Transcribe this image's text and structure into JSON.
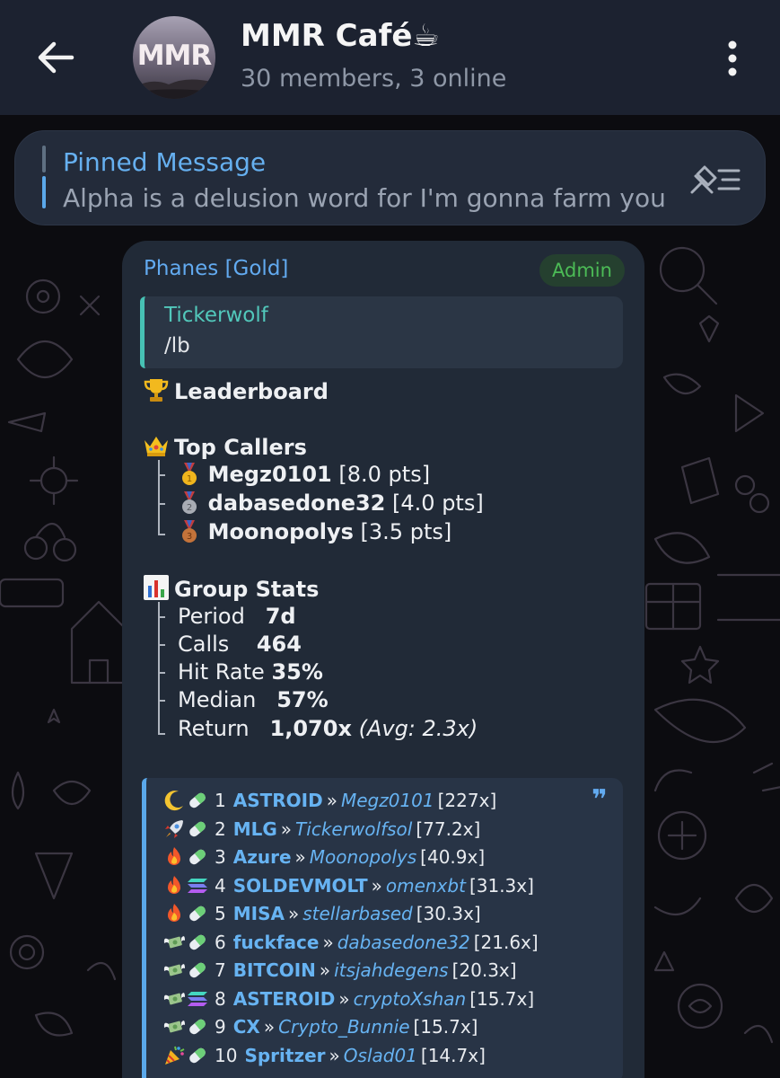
{
  "header": {
    "title": "MMR Café☕",
    "subtitle": "30 members, 3 online",
    "avatar_text": "MMR"
  },
  "pinned": {
    "title": "Pinned Message",
    "text": "Alpha is a delusion word for I'm gonna farm you"
  },
  "message": {
    "sender": "Phanes [Gold]",
    "badge": "Admin",
    "reply": {
      "name": "Tickerwolf",
      "text": "/lb"
    },
    "leaderboard_title": "Leaderboard",
    "top_callers_title": "Top Callers",
    "callers": [
      {
        "medal": "1",
        "name": "Megz0101",
        "pts": "[8.0 pts]"
      },
      {
        "medal": "2",
        "name": "dabasedone32",
        "pts": "[4.0 pts]"
      },
      {
        "medal": "3",
        "name": "Moonopolys",
        "pts": "[3.5 pts]"
      }
    ],
    "group_stats_title": "Group Stats",
    "stats": [
      {
        "label": "Period",
        "value": "7d",
        "extra": ""
      },
      {
        "label": "Calls",
        "value": "464",
        "extra": ""
      },
      {
        "label": "Hit Rate",
        "value": "35%",
        "extra": ""
      },
      {
        "label": "Median",
        "value": "57%",
        "extra": ""
      },
      {
        "label": "Return",
        "value": "1,070x",
        "extra": "(Avg: 2.3x)"
      }
    ],
    "quote_mark": "❞",
    "calls": [
      {
        "icon": "moon",
        "chain": "pill",
        "rank": "1",
        "token": "ASTROID",
        "user": "Megz0101",
        "mult": "[227x]"
      },
      {
        "icon": "rocket",
        "chain": "pill",
        "rank": "2",
        "token": "MLG",
        "user": "Tickerwolfsol",
        "mult": "[77.2x]"
      },
      {
        "icon": "fire",
        "chain": "pill",
        "rank": "3",
        "token": "Azure",
        "user": "Moonopolys",
        "mult": "[40.9x]"
      },
      {
        "icon": "fire",
        "chain": "solana",
        "rank": "4",
        "token": "SOLDEVMOLT",
        "user": "omenxbt",
        "mult": "[31.3x]"
      },
      {
        "icon": "fire",
        "chain": "pill",
        "rank": "5",
        "token": "MISA",
        "user": "stellarbased",
        "mult": "[30.3x]"
      },
      {
        "icon": "money",
        "chain": "pill",
        "rank": "6",
        "token": "fuckface",
        "user": "dabasedone32",
        "mult": "[21.6x]"
      },
      {
        "icon": "money",
        "chain": "pill",
        "rank": "7",
        "token": "BITCOIN",
        "user": "itsjahdegens",
        "mult": "[20.3x]"
      },
      {
        "icon": "money",
        "chain": "solana",
        "rank": "8",
        "token": "ASTEROID",
        "user": "cryptoXshan",
        "mult": "[15.7x]"
      },
      {
        "icon": "money",
        "chain": "pill",
        "rank": "9",
        "token": "CX",
        "user": "Crypto_Bunnie",
        "mult": "[15.7x]"
      },
      {
        "icon": "party",
        "chain": "pill",
        "rank": "10",
        "token": "Spritzer",
        "user": "Oslad01",
        "mult": "[14.7x]"
      }
    ],
    "separator": "»"
  },
  "colors": {
    "header_bg": "#1c2230",
    "bubble_bg": "#212a37",
    "link_blue": "#62aaf0",
    "admin_green": "#4cbb56",
    "reply_teal": "#52c8bb"
  }
}
